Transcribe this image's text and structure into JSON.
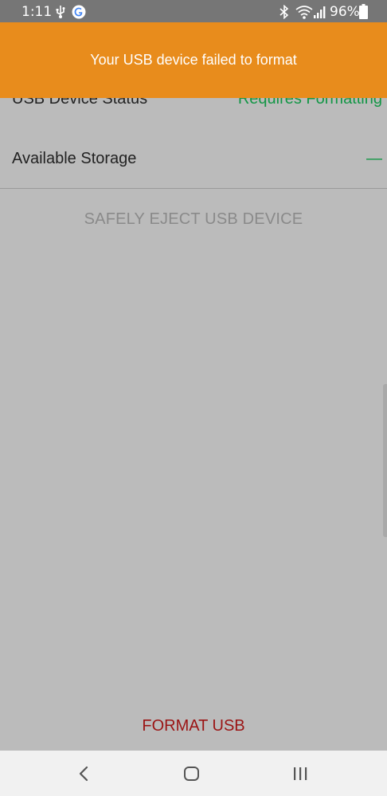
{
  "status_bar": {
    "time": "1:11",
    "battery_percent": "96%",
    "icons": [
      "usb-icon",
      "google-icon",
      "bluetooth-icon",
      "wifi-icon",
      "signal-icon",
      "battery-icon"
    ]
  },
  "banner": {
    "message": "Your USB device failed to format",
    "color": "#e88c1c"
  },
  "details": {
    "status_label": "USB Device Status",
    "status_value": "Requires Formatting",
    "storage_label": "Available Storage",
    "storage_value": "—",
    "value_color": "#129645"
  },
  "actions": {
    "eject_label": "SAFELY EJECT USB DEVICE",
    "format_label": "FORMAT USB",
    "format_color": "#9b1414"
  },
  "nav_bar": {
    "icons": [
      "back-icon",
      "home-icon",
      "recents-icon"
    ]
  }
}
